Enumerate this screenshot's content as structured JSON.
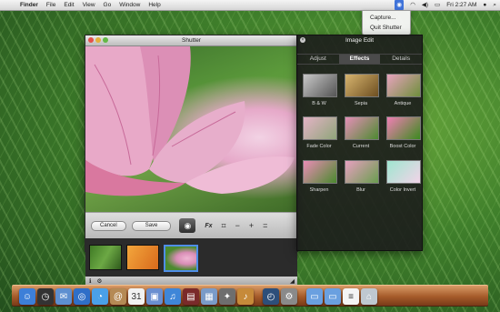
{
  "menubar": {
    "apple_glyph": "",
    "items": [
      "Finder",
      "File",
      "Edit",
      "View",
      "Go",
      "Window",
      "Help"
    ],
    "clock": "Fri 2:27 AM",
    "status_icons": [
      "shutter-status-icon",
      "wifi-icon",
      "volume-icon",
      "battery-icon",
      "user-icon",
      "spotlight-icon"
    ]
  },
  "dropdown": {
    "items": [
      "Capture...",
      "Quit Shutter"
    ]
  },
  "shutter": {
    "title": "Shutter",
    "cancel_label": "Cancel",
    "save_label": "Save",
    "fx_label": "Fx",
    "tools": [
      "crop-icon",
      "minus-icon",
      "plus-icon",
      "equals-icon"
    ],
    "thumbnails": [
      {
        "name": "thumb-grass",
        "color": "#4f8a2e",
        "selected": false
      },
      {
        "name": "thumb-orange",
        "color": "#e58a26",
        "selected": false
      },
      {
        "name": "thumb-flower",
        "color": "#5e9b3a",
        "selected": true
      }
    ]
  },
  "image_edit": {
    "title": "Image Edit",
    "tabs": [
      {
        "label": "Adjust",
        "active": false
      },
      {
        "label": "Effects",
        "active": true
      },
      {
        "label": "Details",
        "active": false
      }
    ],
    "effects": [
      {
        "label": "B & W",
        "bg": "linear-gradient(135deg,#c8c8c8,#555)"
      },
      {
        "label": "Sepia",
        "bg": "linear-gradient(135deg,#d7b46e,#6e4f21)"
      },
      {
        "label": "Antique",
        "bg": "linear-gradient(135deg,#e7a3bd,#6f8f3c)"
      },
      {
        "label": "Fade Color",
        "bg": "linear-gradient(135deg,#e3b3c5,#8fa57a)"
      },
      {
        "label": "Current",
        "bg": "linear-gradient(135deg,#e58fb7,#4d8a31)"
      },
      {
        "label": "Boost Color",
        "bg": "linear-gradient(135deg,#f07fb4,#3c8a1f)"
      },
      {
        "label": "Sharpen",
        "bg": "linear-gradient(135deg,#ea8cb6,#4a8a2e)"
      },
      {
        "label": "Blur",
        "bg": "linear-gradient(135deg,#e7a0c0,#6a9d4f)"
      },
      {
        "label": "Color Invert",
        "bg": "linear-gradient(135deg,#9fe6d0,#f2d4e8)"
      }
    ]
  },
  "dock": {
    "icons": [
      {
        "name": "finder-icon",
        "color": "#3d7fd8"
      },
      {
        "name": "dashboard-icon",
        "color": "#333"
      },
      {
        "name": "mail-icon",
        "color": "#5d8fd0"
      },
      {
        "name": "safari-icon",
        "color": "#2f6fc8"
      },
      {
        "name": "ichat-icon",
        "color": "#4aa0e8"
      },
      {
        "name": "address-book-icon",
        "color": "#b58a55"
      },
      {
        "name": "ical-icon",
        "color": "#f2f2f2"
      },
      {
        "name": "preview-icon",
        "color": "#6a8fd0"
      },
      {
        "name": "itunes-icon",
        "color": "#3f86d8"
      },
      {
        "name": "photo-booth-icon",
        "color": "#7a2a2a"
      },
      {
        "name": "iphoto-icon",
        "color": "#7a9bc8"
      },
      {
        "name": "automator-icon",
        "color": "#6e6e6e"
      },
      {
        "name": "garageband-icon",
        "color": "#c68a3a"
      },
      {
        "name": "gap",
        "color": "transparent"
      },
      {
        "name": "time-machine-icon",
        "color": "#2d4f7a"
      },
      {
        "name": "system-preferences-icon",
        "color": "#8a8a8a"
      },
      {
        "name": "gap",
        "color": "transparent"
      },
      {
        "name": "applications-folder-icon",
        "color": "#6aa0e0"
      },
      {
        "name": "documents-folder-icon",
        "color": "#6aa0e0"
      },
      {
        "name": "text-document-icon",
        "color": "#f4f4f4"
      },
      {
        "name": "trash-icon",
        "color": "#bfc8d0"
      }
    ]
  }
}
